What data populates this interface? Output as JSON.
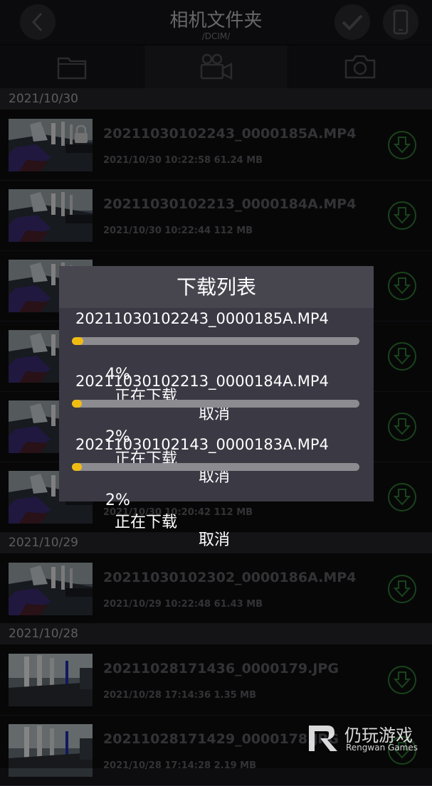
{
  "header": {
    "title": "相机文件夹",
    "path": "/DCIM/"
  },
  "tabs": [
    {
      "name": "folder",
      "icon": "folder-icon"
    },
    {
      "name": "video",
      "icon": "video-camera-icon",
      "active": true
    },
    {
      "name": "photo",
      "icon": "camera-icon"
    }
  ],
  "sections": [
    {
      "date": "2021/10/30"
    },
    {
      "date": "2021/10/29"
    },
    {
      "date": "2021/10/28"
    }
  ],
  "files": [
    {
      "name": "20211030102243_0000185A.MP4",
      "meta": "2021/10/30 10:22:58  61.24 MB",
      "locked": true
    },
    {
      "name": "20211030102213_0000184A.MP4",
      "meta": "2021/10/30 10:22:44  112 MB"
    },
    {
      "name": "",
      "meta": ""
    },
    {
      "name": "",
      "meta": ""
    },
    {
      "name": "",
      "meta": ""
    },
    {
      "name": "",
      "meta": "2021/10/30 10:20:42  112 MB"
    },
    {
      "name": "20211030102302_0000186A.MP4",
      "meta": "2021/10/29 10:22:48  61.43 MB"
    },
    {
      "name": "20211028171436_0000179.JPG",
      "meta": "2021/10/28 17:14:36  1.35 MB"
    },
    {
      "name": "20211028171429_0000178.JPG",
      "meta": "2021/10/28 17:14:28  2.19 MB"
    }
  ],
  "dialog": {
    "title": "下载列表",
    "items": [
      {
        "name": "20211030102243_0000185A.MP4",
        "percent": "4%",
        "progress": 0.04,
        "status": "正在下载",
        "cancel": "取消"
      },
      {
        "name": "20211030102213_0000184A.MP4",
        "percent": "2%",
        "progress": 0.02,
        "status": "正在下载",
        "cancel": "取消"
      },
      {
        "name": "20211030102143_0000183A.MP4",
        "percent": "2%",
        "progress": 0.02,
        "status": "正在下载",
        "cancel": "取消"
      }
    ]
  },
  "watermark": {
    "title": "仍玩游戏",
    "subtitle": "Rengwan Games"
  },
  "colors": {
    "progress_fill": "#f1bc12",
    "download_icon": "#2e7d32",
    "dialog_bg": "#3a3944"
  }
}
